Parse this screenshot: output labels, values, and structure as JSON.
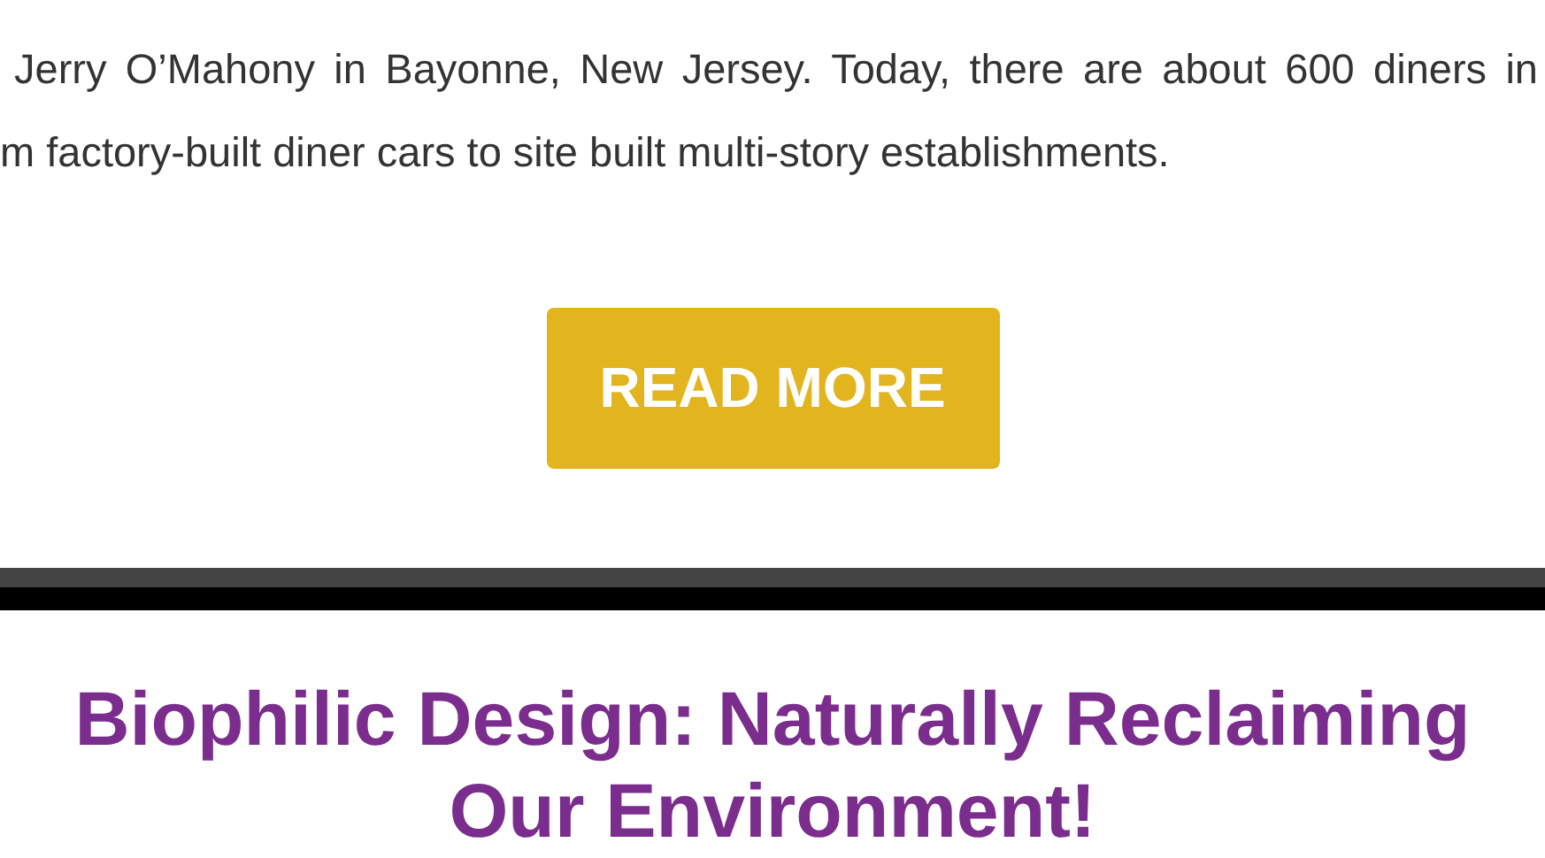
{
  "article": {
    "text_lines": [
      "Jerry O’Mahony in Bayonne, New Jersey. Today, there are about 600 diners in",
      "m factory-built diner cars to site built multi-story establishments."
    ],
    "button": "READ MORE"
  },
  "next_article": {
    "title": "Biophilic Design: Naturally Reclaiming Our Environment!"
  }
}
